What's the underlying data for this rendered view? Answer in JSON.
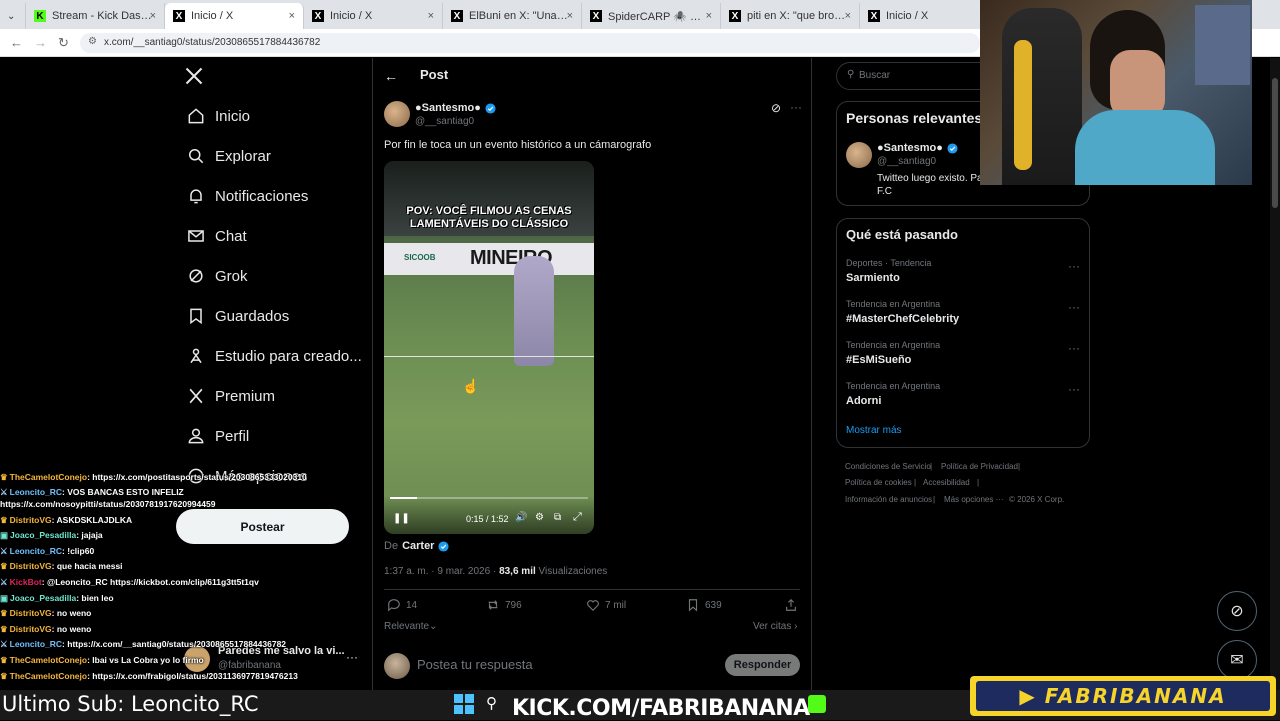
{
  "browser": {
    "tabs": [
      {
        "title": "Stream - Kick Dashboard",
        "favicon": "kick"
      },
      {
        "title": "Inicio / X",
        "favicon": "x"
      },
      {
        "title": "Inicio / X",
        "favicon": "x"
      },
      {
        "title": "ElBuni en X: \"Una kukarda",
        "favicon": "x"
      },
      {
        "title": "SpiderCARP 🕷️ ⚽ en X:",
        "favicon": "x"
      },
      {
        "title": "piti en X: \"que bronca ya",
        "favicon": "x"
      },
      {
        "title": "Inicio / X",
        "favicon": "x"
      }
    ],
    "url": "x.com/__santiag0/status/2030865517884436782"
  },
  "sidebar": {
    "logo": "X",
    "items": [
      {
        "label": "Inicio",
        "icon": "home-icon"
      },
      {
        "label": "Explorar",
        "icon": "search-icon"
      },
      {
        "label": "Notificaciones",
        "icon": "bell-icon"
      },
      {
        "label": "Chat",
        "icon": "mail-icon"
      },
      {
        "label": "Grok",
        "icon": "grok-icon"
      },
      {
        "label": "Guardados",
        "icon": "bookmark-icon"
      },
      {
        "label": "Estudio para creado...",
        "icon": "creator-studio-icon"
      },
      {
        "label": "Premium",
        "icon": "x-premium-icon"
      },
      {
        "label": "Perfil",
        "icon": "person-icon"
      },
      {
        "label": "Más opciones",
        "icon": "more-icon"
      }
    ],
    "post_button": "Postear",
    "account": {
      "name": "Paredes me salvo la vi...",
      "handle": "@fabribanana"
    }
  },
  "post": {
    "header": "Post",
    "author_name": "●Santesmo●",
    "author_handle": "@__santiag0",
    "text": "Por fin le toca un un evento histórico a un cámarografo",
    "video": {
      "caption": "POV: VOCÊ FILMOU AS CENAS LAMENTÁVEIS DO CLÁSSICO",
      "ad_left": "SICOOB",
      "ad_right": "MINEIRO",
      "time": "0:15 / 1:52",
      "progress": 0.134
    },
    "from_prefix": "De",
    "from_name": "Carter",
    "timestamp": "1:37 a. m. · 9 mar. 2026 ·",
    "views": "83,6 mil",
    "views_label": "Visualizaciones",
    "stats": {
      "replies": "14",
      "reposts": "796",
      "likes": "7 mil",
      "bookmarks": "639"
    },
    "sort": "Relevante",
    "quotes": "Ver citas",
    "reply_placeholder": "Postea tu respuesta",
    "reply_button": "Responder"
  },
  "right": {
    "search_placeholder": "Buscar",
    "relevant_title": "Personas relevantes",
    "person": {
      "name": "●Santesmo●",
      "handle": "@__santiag0",
      "bio": "Twitteo luego existo. Pa... F.C"
    },
    "trends_title": "Qué está pasando",
    "trends": [
      {
        "category": "Deportes · Tendencia",
        "name": "Sarmiento"
      },
      {
        "category": "Tendencia en Argentina",
        "name": "#MasterChefCelebrity"
      },
      {
        "category": "Tendencia en Argentina",
        "name": "#EsMiSueño"
      },
      {
        "category": "Tendencia en Argentina",
        "name": "Adorni"
      }
    ],
    "show_more": "Mostrar más",
    "footer": [
      "Condiciones de Servicio",
      "|",
      "Política de Privacidad",
      "|",
      "Política de cookies",
      "|",
      "Accesibilidad",
      "|",
      "Información de anuncios",
      "|",
      "Más opciones ···",
      "© 2026 X Corp."
    ]
  },
  "chat": [
    {
      "user": "TheCamelotConejo",
      "color": "#f5b63c",
      "badge": "crown",
      "msg": "https://x.com/postitasports/status/2030865333020310"
    },
    {
      "user": "Leoncito_RC",
      "color": "#6ec1ff",
      "badge": "sword-moon",
      "msg": "VOS BANCAS ESTO INFELIZ https://x.com/nosoypitti/status/2030781917620994459"
    },
    {
      "user": "DistritoVG",
      "color": "#f5b63c",
      "badge": "crown",
      "msg": "ASKDSKLAJDLKA"
    },
    {
      "user": "Joaco_Pesadilla",
      "color": "#6ee7d0",
      "badge": "square",
      "msg": "jajaja"
    },
    {
      "user": "Leoncito_RC",
      "color": "#6ec1ff",
      "badge": "sword-moon",
      "msg": "!clip60"
    },
    {
      "user": "DistritoVG",
      "color": "#f5b63c",
      "badge": "crown",
      "msg": "que hacia messi"
    },
    {
      "user": "KickBot",
      "color": "#e0245e",
      "badge": "sword-bot",
      "msg": "@Leoncito_RC https://kickbot.com/clip/611g3tt5t1qv"
    },
    {
      "user": "Joaco_Pesadilla",
      "color": "#6ee7d0",
      "badge": "square",
      "msg": "bien leo"
    },
    {
      "user": "DistritoVG",
      "color": "#f5b63c",
      "badge": "crown",
      "msg": "no weno"
    },
    {
      "user": "DistritoVG",
      "color": "#f5b63c",
      "badge": "crown",
      "msg": "no weno"
    },
    {
      "user": "Leoncito_RC",
      "color": "#6ec1ff",
      "badge": "sword-moon",
      "msg": "https://x.com/__santiag0/status/2030865517884436782"
    },
    {
      "user": "TheCamelotConejo",
      "color": "#f5b63c",
      "badge": "crown",
      "msg": "Ibai vs La Cobra yo lo firmo"
    },
    {
      "user": "TheCamelotConejo",
      "color": "#f5b63c",
      "badge": "crown",
      "msg": "https://x.com/frabigol/status/2031136977819476213"
    }
  ],
  "overlay": {
    "last_sub": "Ultimo Sub: Leoncito_RC",
    "kick_url": "KICK.COM/FABRIBANANA",
    "brand": "FABRIBANANA"
  }
}
